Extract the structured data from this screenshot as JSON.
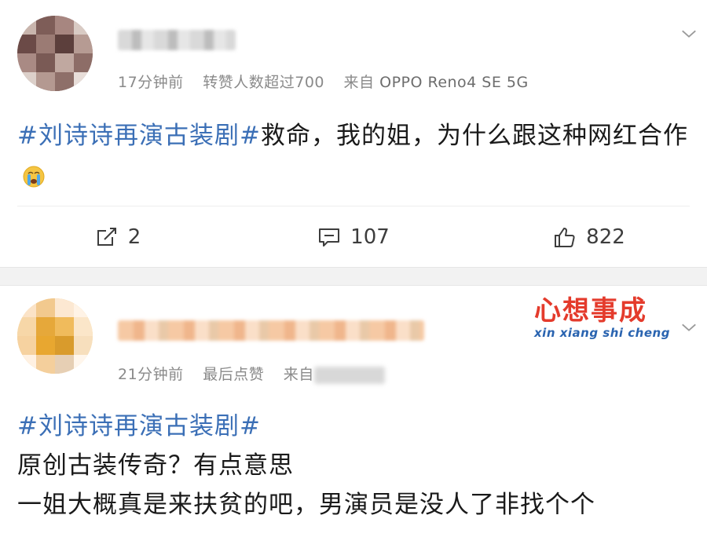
{
  "posts": [
    {
      "meta": {
        "time": "17分钟前",
        "status": "转赞人数超过700",
        "source_label": "来自",
        "source_device": "OPPO Reno4 SE 5G"
      },
      "content": {
        "hashtag": "#刘诗诗再演古装剧#",
        "text": "救命，我的姐，为什么跟这种网红合作"
      },
      "emoji": "crying-face-icon",
      "actions": {
        "repost": "2",
        "comment": "107",
        "like": "822"
      }
    },
    {
      "meta": {
        "time": "21分钟前",
        "status": "最后点赞",
        "source_label": "来自"
      },
      "content": {
        "hashtag": "#刘诗诗再演古装剧#",
        "line1": "原创古装传奇？有点意思",
        "line2": "一姐大概真是来扶贫的吧，男演员是没人了非找个个"
      }
    }
  ],
  "watermark": {
    "cn": "心想事成",
    "pinyin": "xin xiang shi cheng"
  },
  "colors": {
    "hashtag": "#3b6fb6",
    "meta": "#8a8a8a",
    "logo_red": "#e43b2c",
    "logo_blue": "#2a64b0"
  }
}
